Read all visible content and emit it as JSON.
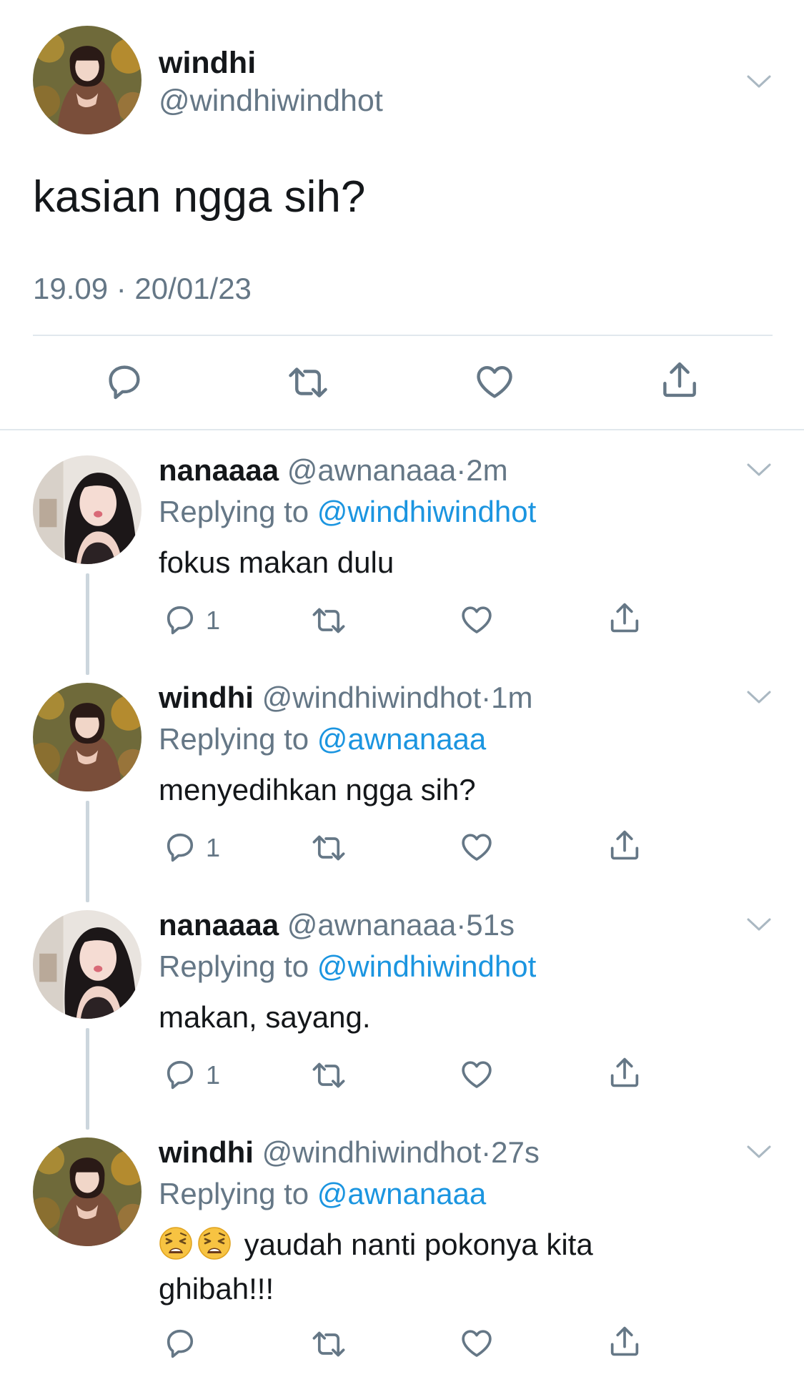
{
  "tweet": {
    "name": "windhi",
    "handle": "@windhiwindhot",
    "text": "kasian ngga sih?",
    "timestamp": "19.09 · 20/01/23",
    "actions": [
      "reply-icon",
      "retweet-icon",
      "like-icon",
      "share-icon"
    ]
  },
  "replies": [
    {
      "name": "nanaaaa",
      "handle": "@awnanaaa",
      "dot": "·",
      "time": "2m",
      "replying_prefix": "Replying to",
      "replying_to": "@windhiwindhot",
      "text": "fokus makan dulu",
      "reply_count": "1"
    },
    {
      "name": "windhi",
      "handle": "@windhiwindhot",
      "dot": "·",
      "time": "1m",
      "replying_prefix": "Replying to",
      "replying_to": "@awnanaaa",
      "text": "menyedihkan ngga sih?",
      "reply_count": "1"
    },
    {
      "name": "nanaaaa",
      "handle": "@awnanaaa",
      "dot": "·",
      "time": "51s",
      "replying_prefix": "Replying to",
      "replying_to": "@windhiwindhot",
      "text": "makan, sayang.",
      "reply_count": "1"
    },
    {
      "name": "windhi",
      "handle": "@windhiwindhot",
      "dot": "·",
      "time": "27s",
      "replying_prefix": "Replying to",
      "replying_to": "@awnanaaa",
      "text": "yaudah nanti pokonya kita ghibah!!!",
      "emoji": [
        "weary-face-emoji",
        "weary-face-emoji"
      ]
    }
  ],
  "colors": {
    "text": "#14171a",
    "secondary": "#657786",
    "link": "#1b95e0",
    "divider": "#e1e8ed",
    "thread_line": "#ccd6dd"
  }
}
